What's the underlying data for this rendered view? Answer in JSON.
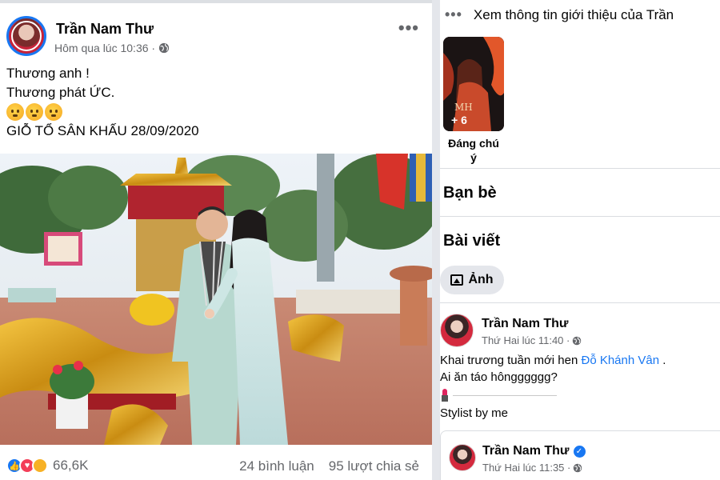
{
  "post": {
    "author": "Trần Nam Thư",
    "meta": "Hôm qua lúc 10:36 ·",
    "more_icon": "more-horizontal-icon",
    "privacy_icon": "globe-icon",
    "text_lines": [
      "Thương anh !",
      "Thương phát ỨC."
    ],
    "emoji": [
      "face-with-hand-over-mouth",
      "face-with-hand-over-mouth",
      "face-with-hand-over-mouth"
    ],
    "text_last": "GIỖ TỔ SÂN KHẤU 28/09/2020",
    "reaction_count": "66,6K",
    "comments": "24 bình luận",
    "shares": "95 lượt chia sẻ"
  },
  "sidebar": {
    "intro_text": "Xem thông tin giới thiệu của Trần",
    "featured_count": "+ 6",
    "featured_label_line1": "Đáng chú",
    "featured_label_line2": "ý",
    "friends_heading": "Bạn bè",
    "posts_heading": "Bài viết",
    "photos_button": "Ảnh"
  },
  "profile_post": {
    "author": "Trần Nam Thư",
    "meta": "Thứ Hai lúc 11:40 ·",
    "text_prefix": "Khai trương tuần mới hen ",
    "mention": "Đỗ Khánh Vân",
    "text_suffix": " .",
    "text_line2": "Ai ăn táo hôngggggg?",
    "stylist": "Stylist by me"
  },
  "profile_post2": {
    "author": "Trần Nam Thư",
    "meta": "Thứ Hai lúc 11:35 ·"
  },
  "colors": {
    "brand_blue": "#1877f2",
    "secondary_text": "#65676b",
    "love_red": "#f33e58",
    "haha_yellow": "#f7b125"
  }
}
